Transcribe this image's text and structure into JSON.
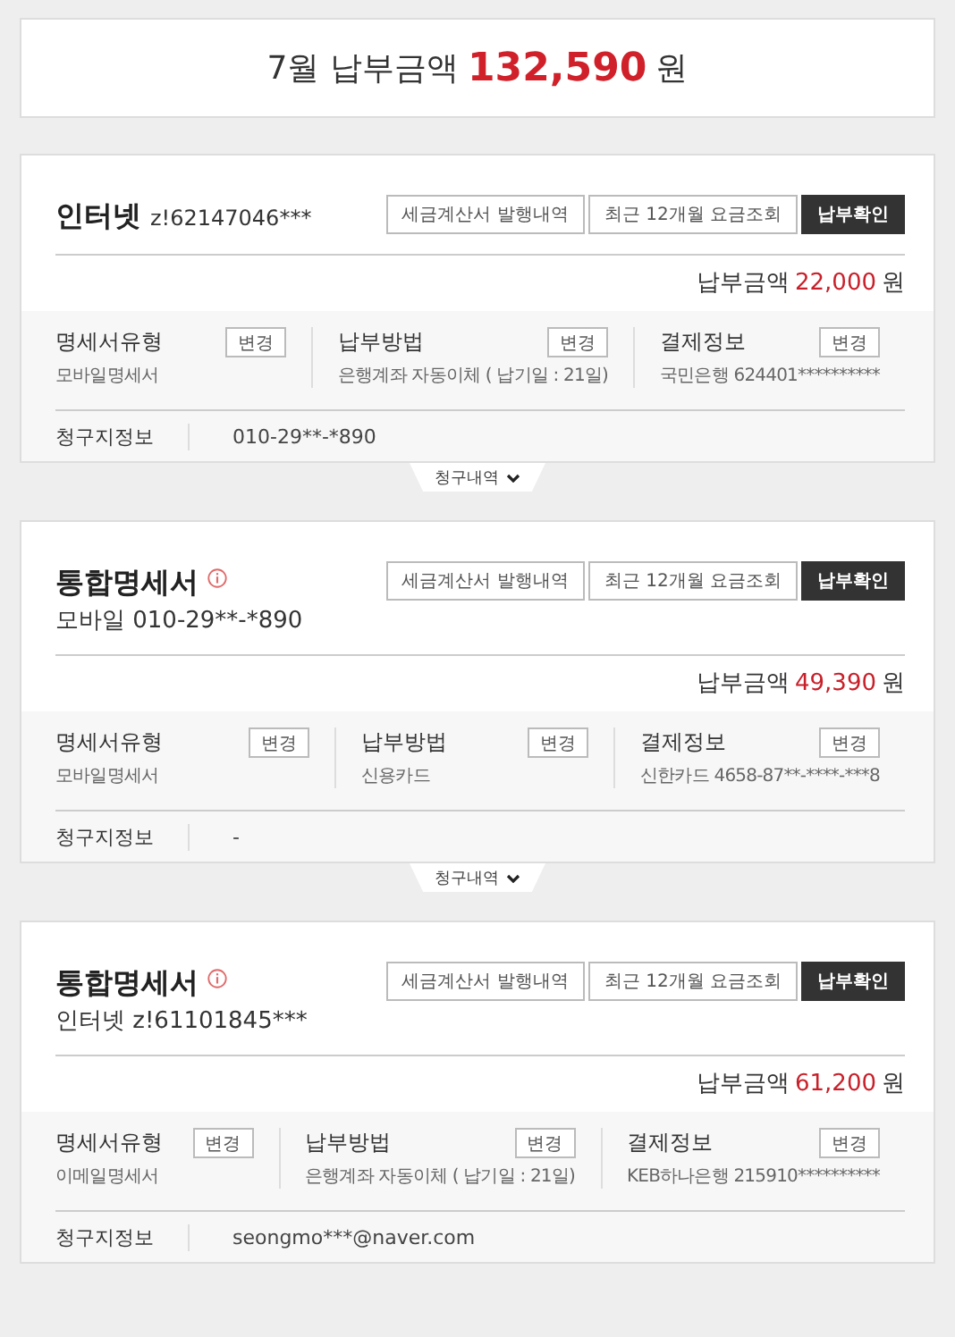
{
  "summary": {
    "label": "7월 납부금액",
    "amount": "132,590",
    "unit": "원"
  },
  "cards": [
    {
      "title": "인터넷",
      "account": "z!62147046***",
      "info_icon": false,
      "buttons": [
        {
          "label": "세금계산서 발행내역",
          "kind": "outline"
        },
        {
          "label": "최근 12개월 요금조회",
          "kind": "outline"
        },
        {
          "label": "납부확인",
          "kind": "dark"
        }
      ],
      "amount_label": "납부금액",
      "amount": "22,000",
      "unit": "원",
      "sections": [
        {
          "label": "명세서유형",
          "button": "변경",
          "value": "모바일명세서"
        },
        {
          "label": "납부방법",
          "button": "변경",
          "value": "은행계좌 자동이체 ( 납기일 : 21일)"
        },
        {
          "label": "결제정보",
          "button": "변경",
          "value": "국민은행 624401**********"
        }
      ],
      "billing_label": "청구지정보",
      "billing_value": "010-29**-*890",
      "toggle": "청구내역"
    },
    {
      "title": "통합명세서",
      "subtitle": "모바일 010-29**-*890",
      "info_icon": true,
      "buttons": [
        {
          "label": "세금계산서 발행내역",
          "kind": "outline"
        },
        {
          "label": "최근 12개월 요금조회",
          "kind": "outline"
        },
        {
          "label": "납부확인",
          "kind": "dark"
        }
      ],
      "amount_label": "납부금액",
      "amount": "49,390",
      "unit": "원",
      "sections": [
        {
          "label": "명세서유형",
          "button": "변경",
          "value": "모바일명세서"
        },
        {
          "label": "납부방법",
          "button": "변경",
          "value": "신용카드"
        },
        {
          "label": "결제정보",
          "button": "변경",
          "value": "신한카드 4658-87**-****-***8"
        }
      ],
      "billing_label": "청구지정보",
      "billing_value": "-",
      "toggle": "청구내역"
    },
    {
      "title": "통합명세서",
      "subtitle": "인터넷 z!61101845***",
      "info_icon": true,
      "buttons": [
        {
          "label": "세금계산서 발행내역",
          "kind": "outline"
        },
        {
          "label": "최근 12개월 요금조회",
          "kind": "outline"
        },
        {
          "label": "납부확인",
          "kind": "dark"
        }
      ],
      "amount_label": "납부금액",
      "amount": "61,200",
      "unit": "원",
      "sections": [
        {
          "label": "명세서유형",
          "button": "변경",
          "value": "이메일명세서"
        },
        {
          "label": "납부방법",
          "button": "변경",
          "value": "은행계좌 자동이체 ( 납기일 : 21일)"
        },
        {
          "label": "결제정보",
          "button": "변경",
          "value": "KEB하나은행 215910**********"
        }
      ],
      "billing_label": "청구지정보",
      "billing_value": "seongmo***@naver.com"
    }
  ]
}
